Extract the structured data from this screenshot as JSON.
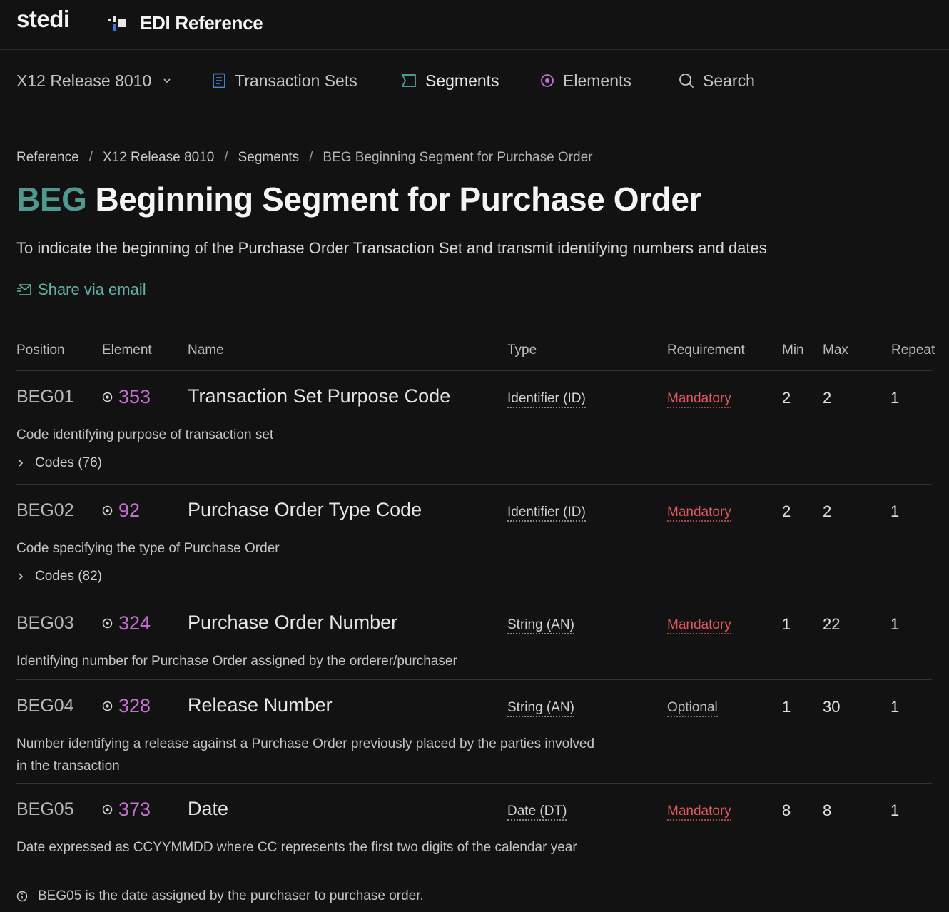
{
  "header": {
    "logo": "stedi",
    "app_title": "EDI Reference"
  },
  "nav": {
    "release": "X12 Release 8010",
    "transaction_sets": "Transaction Sets",
    "segments": "Segments",
    "elements": "Elements",
    "search": "Search"
  },
  "breadcrumb": {
    "items": [
      "Reference",
      "X12 Release 8010",
      "Segments"
    ],
    "current": "BEG Beginning Segment for Purchase Order"
  },
  "page": {
    "code": "BEG",
    "title": "Beginning Segment for Purchase Order",
    "description": "To indicate the beginning of the Purchase Order Transaction Set and transmit identifying numbers and dates",
    "share_label": "Share via email"
  },
  "table": {
    "headers": [
      "Position",
      "Element",
      "Name",
      "Type",
      "Requirement",
      "Min",
      "Max",
      "Repeat"
    ],
    "rows": [
      {
        "position": "BEG01",
        "element": "353",
        "name": "Transaction Set Purpose Code",
        "type": "Identifier (ID)",
        "requirement": "Mandatory",
        "min": "2",
        "max": "2",
        "repeat": "1",
        "description": "Code identifying purpose of transaction set",
        "codes": "Codes (76)"
      },
      {
        "position": "BEG02",
        "element": "92",
        "name": "Purchase Order Type Code",
        "type": "Identifier (ID)",
        "requirement": "Mandatory",
        "min": "2",
        "max": "2",
        "repeat": "1",
        "description": "Code specifying the type of Purchase Order",
        "codes": "Codes (82)"
      },
      {
        "position": "BEG03",
        "element": "324",
        "name": "Purchase Order Number",
        "type": "String (AN)",
        "requirement": "Mandatory",
        "min": "1",
        "max": "22",
        "repeat": "1",
        "description": "Identifying number for Purchase Order assigned by the orderer/purchaser"
      },
      {
        "position": "BEG04",
        "element": "328",
        "name": "Release Number",
        "type": "String (AN)",
        "requirement": "Optional",
        "min": "1",
        "max": "30",
        "repeat": "1",
        "description": "Number identifying a release against a Purchase Order previously placed by the parties involved in the transaction"
      },
      {
        "position": "BEG05",
        "element": "373",
        "name": "Date",
        "type": "Date (DT)",
        "requirement": "Mandatory",
        "min": "8",
        "max": "8",
        "repeat": "1",
        "description": "Date expressed as CCYYMMDD where CC represents the first two digits of the calendar year",
        "note": "BEG05 is the date assigned by the purchaser to purchase order."
      }
    ]
  },
  "colors": {
    "background": "#121212",
    "accent_teal": "#4f9a8e",
    "element_purple": "#c86fd6",
    "mandatory_red": "#e0575d"
  }
}
